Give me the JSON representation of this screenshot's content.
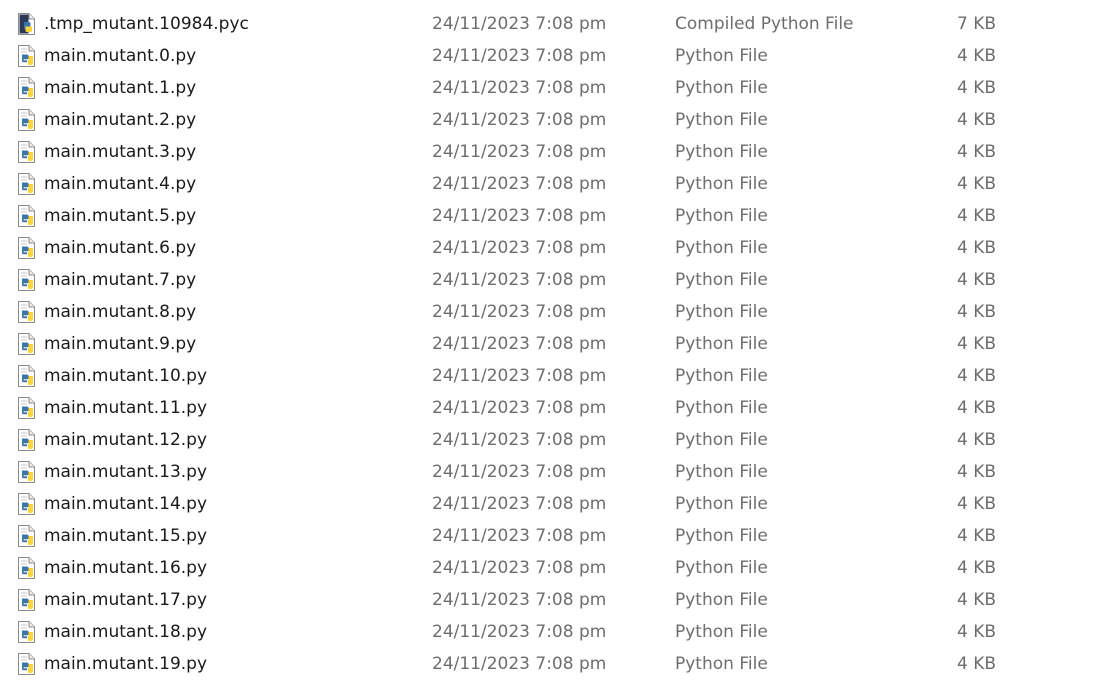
{
  "files": [
    {
      "name": ".tmp_mutant.10984.pyc",
      "date": "24/11/2023 7:08 pm",
      "type": "Compiled Python File",
      "size": "7 KB",
      "icon": "pyc-file-icon"
    },
    {
      "name": "main.mutant.0.py",
      "date": "24/11/2023 7:08 pm",
      "type": "Python File",
      "size": "4 KB",
      "icon": "python-file-icon"
    },
    {
      "name": "main.mutant.1.py",
      "date": "24/11/2023 7:08 pm",
      "type": "Python File",
      "size": "4 KB",
      "icon": "python-file-icon"
    },
    {
      "name": "main.mutant.2.py",
      "date": "24/11/2023 7:08 pm",
      "type": "Python File",
      "size": "4 KB",
      "icon": "python-file-icon"
    },
    {
      "name": "main.mutant.3.py",
      "date": "24/11/2023 7:08 pm",
      "type": "Python File",
      "size": "4 KB",
      "icon": "python-file-icon"
    },
    {
      "name": "main.mutant.4.py",
      "date": "24/11/2023 7:08 pm",
      "type": "Python File",
      "size": "4 KB",
      "icon": "python-file-icon"
    },
    {
      "name": "main.mutant.5.py",
      "date": "24/11/2023 7:08 pm",
      "type": "Python File",
      "size": "4 KB",
      "icon": "python-file-icon"
    },
    {
      "name": "main.mutant.6.py",
      "date": "24/11/2023 7:08 pm",
      "type": "Python File",
      "size": "4 KB",
      "icon": "python-file-icon"
    },
    {
      "name": "main.mutant.7.py",
      "date": "24/11/2023 7:08 pm",
      "type": "Python File",
      "size": "4 KB",
      "icon": "python-file-icon"
    },
    {
      "name": "main.mutant.8.py",
      "date": "24/11/2023 7:08 pm",
      "type": "Python File",
      "size": "4 KB",
      "icon": "python-file-icon"
    },
    {
      "name": "main.mutant.9.py",
      "date": "24/11/2023 7:08 pm",
      "type": "Python File",
      "size": "4 KB",
      "icon": "python-file-icon"
    },
    {
      "name": "main.mutant.10.py",
      "date": "24/11/2023 7:08 pm",
      "type": "Python File",
      "size": "4 KB",
      "icon": "python-file-icon"
    },
    {
      "name": "main.mutant.11.py",
      "date": "24/11/2023 7:08 pm",
      "type": "Python File",
      "size": "4 KB",
      "icon": "python-file-icon"
    },
    {
      "name": "main.mutant.12.py",
      "date": "24/11/2023 7:08 pm",
      "type": "Python File",
      "size": "4 KB",
      "icon": "python-file-icon"
    },
    {
      "name": "main.mutant.13.py",
      "date": "24/11/2023 7:08 pm",
      "type": "Python File",
      "size": "4 KB",
      "icon": "python-file-icon"
    },
    {
      "name": "main.mutant.14.py",
      "date": "24/11/2023 7:08 pm",
      "type": "Python File",
      "size": "4 KB",
      "icon": "python-file-icon"
    },
    {
      "name": "main.mutant.15.py",
      "date": "24/11/2023 7:08 pm",
      "type": "Python File",
      "size": "4 KB",
      "icon": "python-file-icon"
    },
    {
      "name": "main.mutant.16.py",
      "date": "24/11/2023 7:08 pm",
      "type": "Python File",
      "size": "4 KB",
      "icon": "python-file-icon"
    },
    {
      "name": "main.mutant.17.py",
      "date": "24/11/2023 7:08 pm",
      "type": "Python File",
      "size": "4 KB",
      "icon": "python-file-icon"
    },
    {
      "name": "main.mutant.18.py",
      "date": "24/11/2023 7:08 pm",
      "type": "Python File",
      "size": "4 KB",
      "icon": "python-file-icon"
    },
    {
      "name": "main.mutant.19.py",
      "date": "24/11/2023 7:08 pm",
      "type": "Python File",
      "size": "4 KB",
      "icon": "python-file-icon"
    }
  ],
  "colors": {
    "python_blue": "#3776ab",
    "python_yellow": "#ffd43b",
    "pyc_dark": "#2b3a55",
    "text_primary": "#1a1a1a",
    "text_secondary": "#6d6d6d"
  }
}
